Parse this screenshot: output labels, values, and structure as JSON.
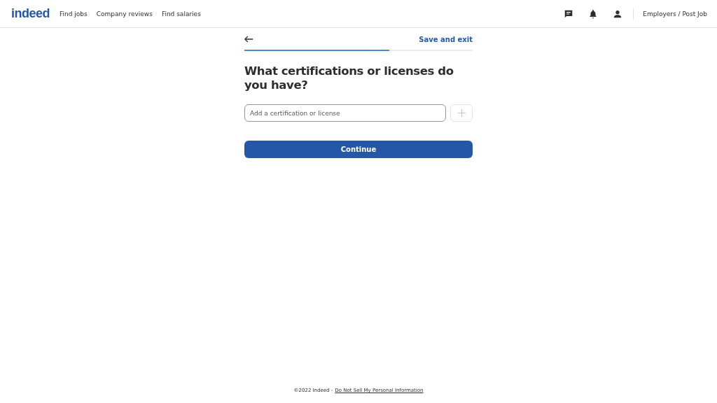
{
  "header": {
    "logo": "indeed",
    "nav": [
      "Find jobs",
      "Company reviews",
      "Find salaries"
    ],
    "employers_link": "Employers / Post Job"
  },
  "form": {
    "save_exit": "Save and exit",
    "progress": {
      "level": 0.635
    },
    "question": "What certifications or licenses do you have?",
    "field": {
      "placeholder": "Add a certification or license"
    },
    "add_button": {
      "disabled": true
    },
    "continue": "Continue"
  },
  "footer": {
    "copyright": "©2022 Indeed -",
    "link": "Do Not Sell My Personal Information"
  }
}
